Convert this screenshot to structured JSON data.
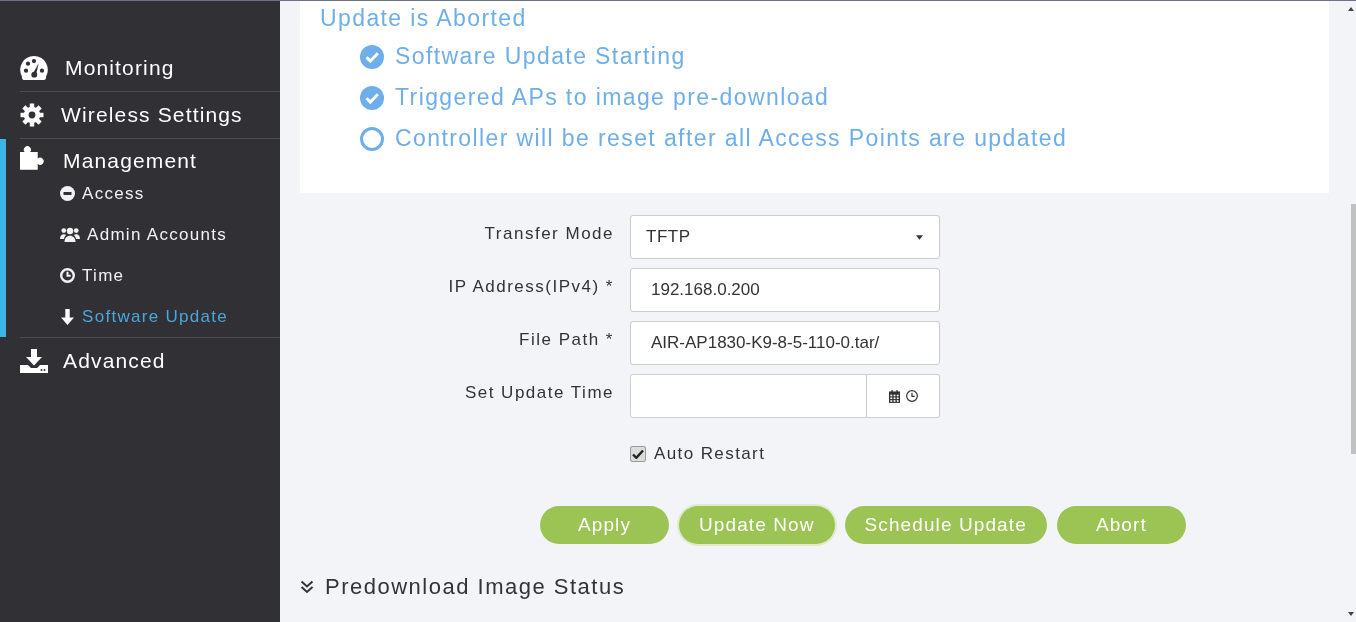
{
  "sidebar": {
    "items": [
      {
        "label": "Monitoring",
        "selected": false
      },
      {
        "label": "Wireless Settings",
        "selected": false
      },
      {
        "label": "Management",
        "selected": true,
        "children": [
          {
            "label": "Access",
            "selected": false
          },
          {
            "label": "Admin Accounts",
            "selected": false
          },
          {
            "label": "Time",
            "selected": false
          },
          {
            "label": "Software Update",
            "selected": true
          }
        ]
      },
      {
        "label": "Advanced",
        "selected": false
      }
    ]
  },
  "status_panel": {
    "title": "Update is Aborted",
    "steps": [
      {
        "label": "Software Update Starting",
        "done": true
      },
      {
        "label": "Triggered APs to image pre-download",
        "done": true
      },
      {
        "label": "Controller will be reset after all Access Points are updated",
        "done": false
      }
    ]
  },
  "form": {
    "fields": [
      {
        "kind": "select",
        "label": "Transfer Mode",
        "value": "TFTP"
      },
      {
        "kind": "text",
        "label": "IP Address(IPv4) *",
        "value": "192.168.0.200"
      },
      {
        "kind": "text",
        "label": "File Path *",
        "value": "AIR-AP1830-K9-8-5-110-0.tar/"
      },
      {
        "kind": "datetime",
        "label": "Set Update Time"
      }
    ],
    "auto_restart": {
      "label": "Auto Restart",
      "checked": true
    }
  },
  "buttons": [
    {
      "label": "Apply",
      "focused": false
    },
    {
      "label": "Update Now",
      "focused": true
    },
    {
      "label": "Schedule Update",
      "focused": false
    },
    {
      "label": "Abort",
      "focused": false
    }
  ],
  "predownload_section": {
    "title": "Predownload Image Status"
  }
}
